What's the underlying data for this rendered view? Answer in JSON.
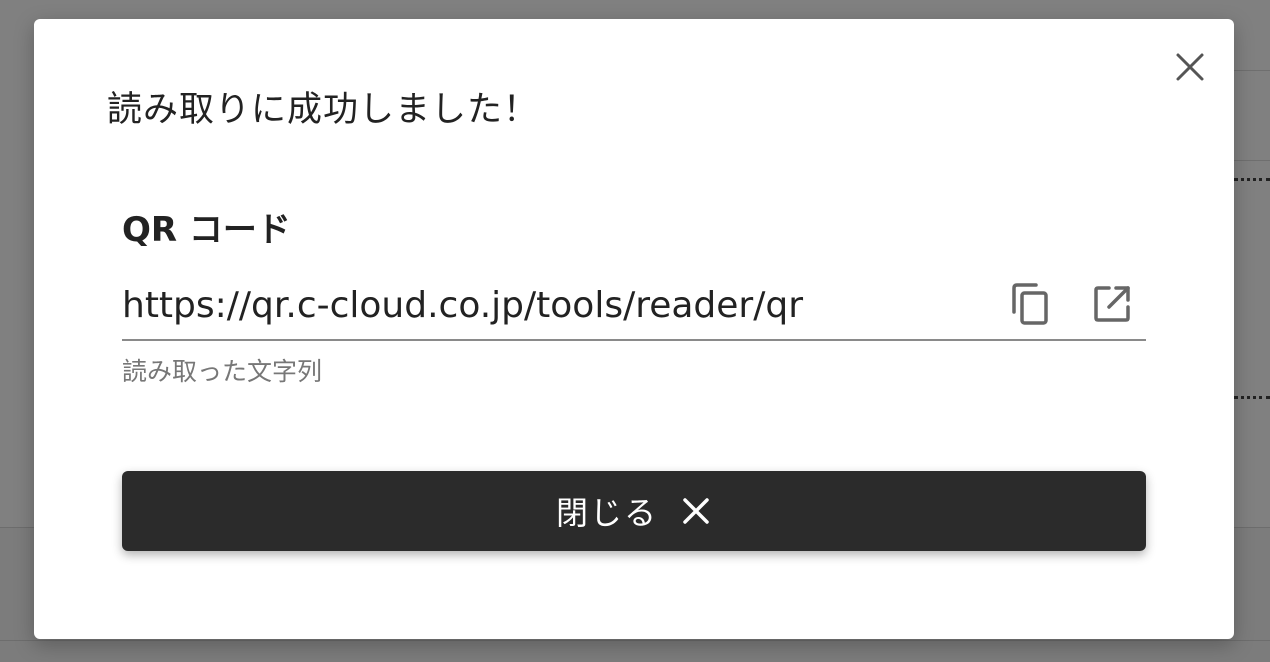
{
  "dialog": {
    "title": "読み取りに成功しました！",
    "close_icon": "close-icon"
  },
  "field": {
    "label": "QR コード",
    "value": "https://qr.c-cloud.co.jp/tools/reader/qr",
    "helper": "読み取った文字列",
    "copy_icon": "copy-icon",
    "open_icon": "open-in-new-icon"
  },
  "close_button": {
    "label": "閉じる",
    "icon": "close-icon"
  },
  "colors": {
    "button_bg": "#2b2b2b",
    "backdrop": "#808080",
    "text": "#222222",
    "helper_text": "#777777"
  }
}
